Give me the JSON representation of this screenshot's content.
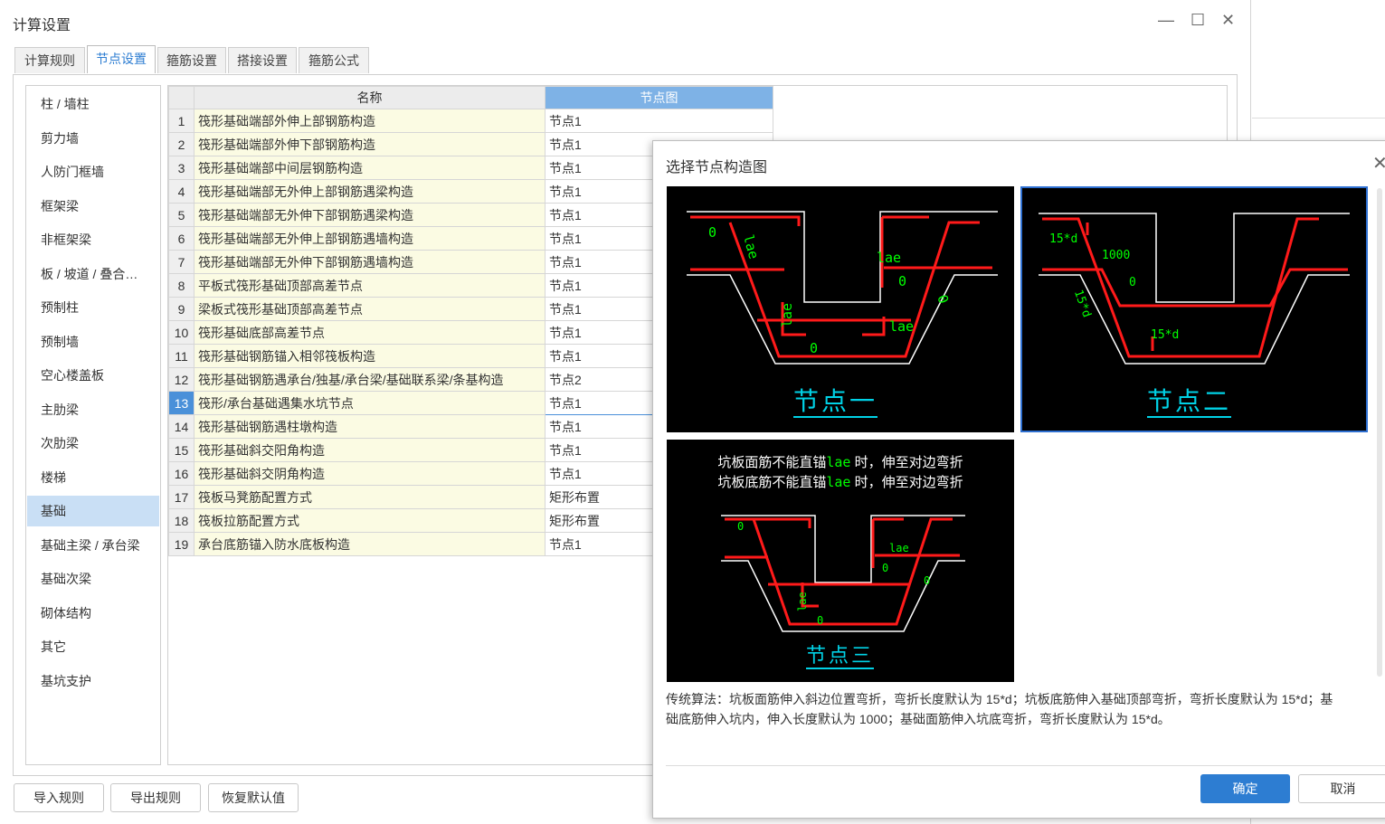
{
  "window": {
    "title": "计算设置",
    "min_icon": "minimize-icon",
    "max_icon": "maximize-icon",
    "close_icon": "close-icon",
    "min_glyph": "—",
    "max_glyph": "☐",
    "close_glyph": "✕"
  },
  "tabs": [
    {
      "label": "计算规则",
      "active": false
    },
    {
      "label": "节点设置",
      "active": true
    },
    {
      "label": "箍筋设置",
      "active": false
    },
    {
      "label": "搭接设置",
      "active": false
    },
    {
      "label": "箍筋公式",
      "active": false
    }
  ],
  "sidebar": {
    "active_index": 12,
    "items": [
      "柱 / 墙柱",
      "剪力墙",
      "人防门框墙",
      "框架梁",
      "非框架梁",
      "板 / 坡道 / 叠合…",
      "预制柱",
      "预制墙",
      "空心楼盖板",
      "主肋梁",
      "次肋梁",
      "楼梯",
      "基础",
      "基础主梁 / 承台梁",
      "基础次梁",
      "砌体结构",
      "其它",
      "基坑支护"
    ]
  },
  "table": {
    "headers": {
      "name": "名称",
      "node": "节点图"
    },
    "selected_row": 13,
    "rows": [
      {
        "no": "1",
        "name": "筏形基础端部外伸上部钢筋构造",
        "node": "节点1"
      },
      {
        "no": "2",
        "name": "筏形基础端部外伸下部钢筋构造",
        "node": "节点1"
      },
      {
        "no": "3",
        "name": "筏形基础端部中间层钢筋构造",
        "node": "节点1"
      },
      {
        "no": "4",
        "name": "筏形基础端部无外伸上部钢筋遇梁构造",
        "node": "节点1"
      },
      {
        "no": "5",
        "name": "筏形基础端部无外伸下部钢筋遇梁构造",
        "node": "节点1"
      },
      {
        "no": "6",
        "name": "筏形基础端部无外伸上部钢筋遇墙构造",
        "node": "节点1"
      },
      {
        "no": "7",
        "name": "筏形基础端部无外伸下部钢筋遇墙构造",
        "node": "节点1"
      },
      {
        "no": "8",
        "name": "平板式筏形基础顶部高差节点",
        "node": "节点1"
      },
      {
        "no": "9",
        "name": "梁板式筏形基础顶部高差节点",
        "node": "节点1"
      },
      {
        "no": "10",
        "name": "筏形基础底部高差节点",
        "node": "节点1"
      },
      {
        "no": "11",
        "name": "筏形基础钢筋锚入相邻筏板构造",
        "node": "节点1"
      },
      {
        "no": "12",
        "name": "筏形基础钢筋遇承台/独基/承台梁/基础联系梁/条基构造",
        "node": "节点2"
      },
      {
        "no": "13",
        "name": "筏形/承台基础遇集水坑节点",
        "node": "节点1"
      },
      {
        "no": "14",
        "name": "筏形基础钢筋遇柱墩构造",
        "node": "节点1"
      },
      {
        "no": "15",
        "name": "筏形基础斜交阳角构造",
        "node": "节点1"
      },
      {
        "no": "16",
        "name": "筏形基础斜交阴角构造",
        "node": "节点1"
      },
      {
        "no": "17",
        "name": "筏板马凳筋配置方式",
        "node": "矩形布置"
      },
      {
        "no": "18",
        "name": "筏板拉筋配置方式",
        "node": "矩形布置"
      },
      {
        "no": "19",
        "name": "承台底筋锚入防水底板构造",
        "node": "节点1"
      }
    ]
  },
  "buttons": {
    "import": "导入规则",
    "export": "导出规则",
    "reset": "恢复默认值"
  },
  "modal": {
    "title": "选择节点构造图",
    "close_glyph": "✕",
    "diagrams": [
      {
        "label": "节点一",
        "selected": false,
        "annotations": {
          "d1": "0",
          "d2": "lae",
          "d3": "lae",
          "d4": "0",
          "d5": "0",
          "d6": "lae",
          "d7": "0",
          "d8": "lae"
        }
      },
      {
        "label": "节点二",
        "selected": true,
        "annotations": {
          "d1": "15*d",
          "d2": "1000",
          "d3": "0",
          "d4": "15*d",
          "d5": "15*d"
        }
      },
      {
        "label": "节点三",
        "selected": false,
        "note_line1_a": "坑板面筋不能直锚",
        "note_line1_b": "lae",
        "note_line1_c": " 时，伸至对边弯折",
        "note_line2_a": "坑板底筋不能直锚",
        "note_line2_b": "lae",
        "note_line2_c": " 时，伸至对边弯折",
        "annotations": {
          "d1": "0",
          "d2": "lae",
          "d3": "0",
          "d4": "lae",
          "d5": "0",
          "d6": "0"
        }
      }
    ],
    "description": "传统算法：坑板面筋伸入斜边位置弯折，弯折长度默认为 15*d；坑板底筋伸入基础顶部弯折，弯折长度默认为 15*d；基\n础底筋伸入坑内，伸入长度默认为 1000；基础面筋伸入坑底弯折，弯折长度默认为 15*d。",
    "ok": "确定",
    "cancel": "取消"
  },
  "colors": {
    "accent": "#2d7dd2",
    "header_selected": "#7eb2e6",
    "sidebar_selected": "#c9dff5",
    "name_cell": "#fbfbe3",
    "rebar": "#ff1a1a",
    "concrete": "#ffffff",
    "dim_text": "#00ff00",
    "label": "#00d2e6"
  }
}
